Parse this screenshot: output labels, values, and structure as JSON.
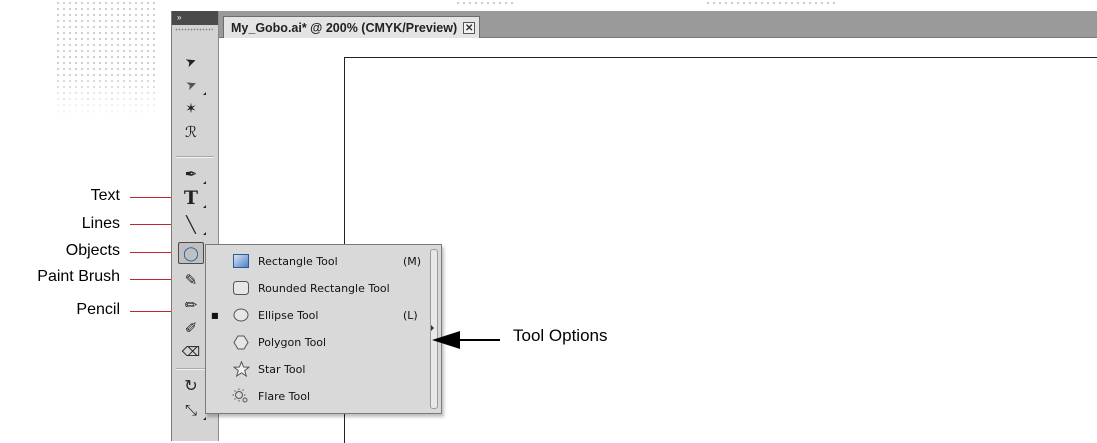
{
  "document_tab": {
    "title": "My_Gobo.ai* @ 200% (CMYK/Preview)",
    "close_glyph": "✕"
  },
  "toolbar": {
    "collapse_glyph": "»",
    "tools": [
      {
        "name": "selection-tool-icon",
        "glyph": "➤"
      },
      {
        "name": "direct-selection-tool-icon",
        "glyph": "➤"
      },
      {
        "name": "magic-wand-tool-icon",
        "glyph": "✶"
      },
      {
        "name": "lasso-tool-icon",
        "glyph": "ℛ"
      },
      {
        "name": "pen-tool-icon",
        "glyph": "✒"
      },
      {
        "name": "type-tool-icon",
        "glyph": "T"
      },
      {
        "name": "line-segment-tool-icon",
        "glyph": "╲"
      },
      {
        "name": "ellipse-tool-icon",
        "glyph": "◯"
      },
      {
        "name": "paintbrush-tool-icon",
        "glyph": "✎"
      },
      {
        "name": "pencil-tool-icon",
        "glyph": "✏"
      },
      {
        "name": "blob-brush-tool-icon",
        "glyph": "✐"
      },
      {
        "name": "eraser-tool-icon",
        "glyph": "⌫"
      },
      {
        "name": "rotate-tool-icon",
        "glyph": "↻"
      },
      {
        "name": "scale-tool-icon",
        "glyph": "⤡"
      }
    ]
  },
  "callouts": {
    "text": "Text",
    "lines": "Lines",
    "objects": "Objects",
    "paint_brush": "Paint Brush",
    "pencil": "Pencil"
  },
  "flyout": {
    "items": [
      {
        "label": "Rectangle Tool",
        "shortcut": "(M)",
        "icon": "rectangle-icon",
        "selected": false
      },
      {
        "label": "Rounded Rectangle Tool",
        "shortcut": "",
        "icon": "rounded-rectangle-icon",
        "selected": false
      },
      {
        "label": "Ellipse Tool",
        "shortcut": "(L)",
        "icon": "ellipse-icon",
        "selected": true,
        "mark": "■"
      },
      {
        "label": "Polygon Tool",
        "shortcut": "",
        "icon": "polygon-icon",
        "selected": false
      },
      {
        "label": "Star Tool",
        "shortcut": "",
        "icon": "star-icon",
        "selected": false
      },
      {
        "label": "Flare Tool",
        "shortcut": "",
        "icon": "flare-icon",
        "selected": false
      }
    ]
  },
  "tool_options_label": "Tool Options",
  "colors": {
    "callout_line": "#c0272d",
    "toolbar_bg": "#d4d4d4",
    "tabbar_bg": "#9a9a9a"
  }
}
